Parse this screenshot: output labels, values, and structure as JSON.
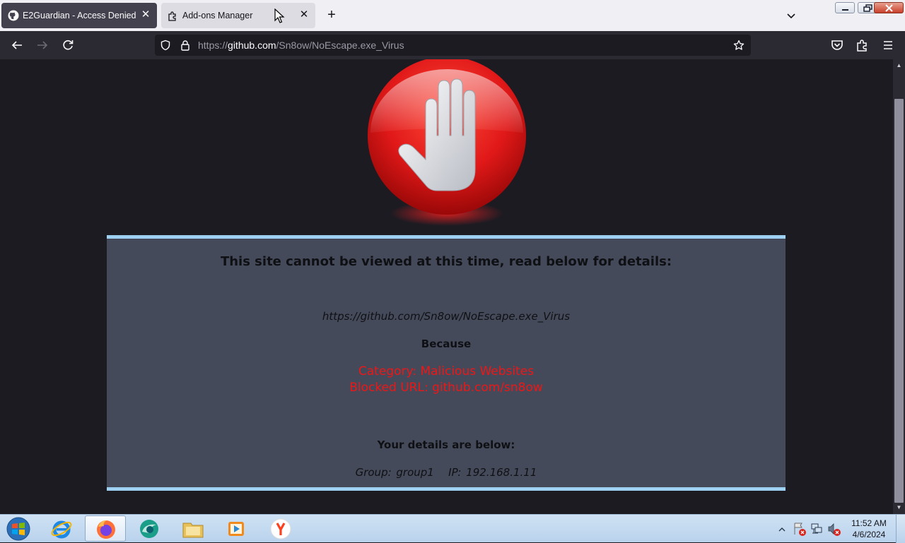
{
  "browser": {
    "tabs": [
      {
        "title": "E2Guardian - Access Denied",
        "active": true,
        "icon": "github-icon"
      },
      {
        "title": "Add-ons Manager",
        "active": false,
        "icon": "puzzle-icon"
      }
    ],
    "url": {
      "scheme": "https://",
      "host": "github.com",
      "path": "/Sn8ow/NoEscape.exe_Virus"
    },
    "colors": {
      "toolbar": "#2b2a33",
      "tabstrip": "#f0f0f4",
      "urlbar": "#1c1b22"
    }
  },
  "page": {
    "heading": "This site cannot be viewed at this time, read below for details:",
    "blocked_url": "https://github.com/Sn8ow/NoEscape.exe_Virus",
    "because_label": "Because",
    "reason_category": "Category: Malicious Websites",
    "reason_blocked_url": "Blocked URL: github.com/sn8ow",
    "details_title": "Your details are below:",
    "details_line": "Group: group1   IP: 192.168.1.11",
    "colors": {
      "panel": "#454a5a",
      "panel_border": "#9ed0f2",
      "reason_text": "#ee1616",
      "stop_sign": "#e01818"
    }
  },
  "taskbar": {
    "apps": [
      "internet-explorer-icon",
      "firefox-icon",
      "browser-icon",
      "file-explorer-icon",
      "media-player-icon",
      "yandex-icon"
    ],
    "active_app": "firefox-icon",
    "clock": {
      "time": "11:52 AM",
      "date": "4/6/2024"
    }
  }
}
